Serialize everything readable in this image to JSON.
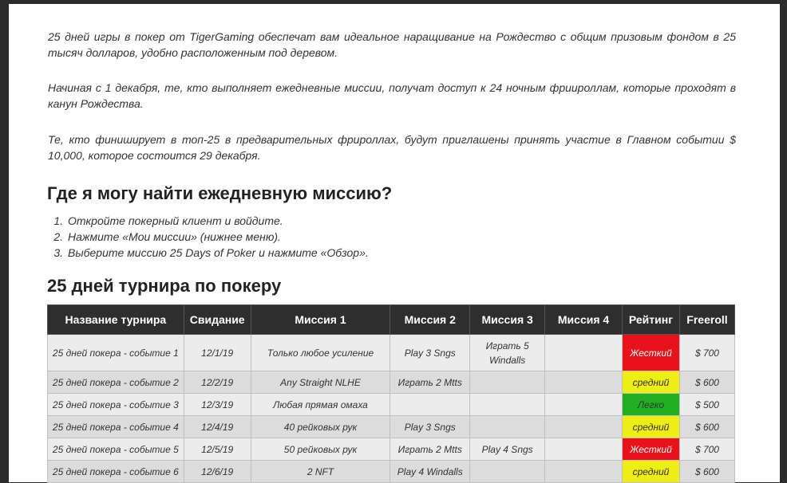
{
  "paragraphs": [
    "25 дней игры в покер от TigerGaming обеспечат вам идеальное наращивание на Рождество с общим призовым фондом в 25 тысяч долларов, удобно расположенным под деревом.",
    "Начиная с 1 декабря, те, кто выполняет ежедневные миссии, получат доступ к 24 ночным фриироллам, которые проходят в канун Рождества.",
    "Те, кто финиширует в топ-25 в предварительных фрироллах, будут приглашены принять участие в Главном событии $ 10,000, которое состоится 29 декабря."
  ],
  "heading_mission": "Где я могу найти ежедневную миссию?",
  "steps": [
    "Откройте покерный клиент и войдите.",
    "Нажмите «Мои миссии» (нижнее меню).",
    "Выберите миссию 25 Days of Poker и нажмите «Обзор»."
  ],
  "heading_table": "25 дней турнира по покеру",
  "table": {
    "headers": [
      "Название турнира",
      "Свидание",
      "Миссия 1",
      "Миссия 2",
      "Миссия 3",
      "Миссия 4",
      "Рейтинг",
      "Freeroll"
    ],
    "rows": [
      {
        "name": "25 дней покера - событие 1",
        "date": "12/1/19",
        "m1": "Только любое усиление",
        "m2": "Play 3 Sngs",
        "m3": "Играть 5 Windalls",
        "m4": "",
        "rating": "Жесткий",
        "rating_level": "hard",
        "freeroll": "$ 700"
      },
      {
        "name": "25 дней покера - событие 2",
        "date": "12/2/19",
        "m1": "Any Straight NLHE",
        "m2": "Играть 2 Mtts",
        "m3": "",
        "m4": "",
        "rating": "средний",
        "rating_level": "mid",
        "freeroll": "$ 600"
      },
      {
        "name": "25 дней покера - событие 3",
        "date": "12/3/19",
        "m1": "Любая прямая омаха",
        "m2": "",
        "m3": "",
        "m4": "",
        "rating": "Легко",
        "rating_level": "easy",
        "freeroll": "$ 500"
      },
      {
        "name": "25 дней покера - событие 4",
        "date": "12/4/19",
        "m1": "40 рейковых рук",
        "m2": "Play 3 Sngs",
        "m3": "",
        "m4": "",
        "rating": "средний",
        "rating_level": "mid",
        "freeroll": "$ 600"
      },
      {
        "name": "25 дней покера - событие 5",
        "date": "12/5/19",
        "m1": "50 рейковых рук",
        "m2": "Играть 2 Mtts",
        "m3": "Play 4 Sngs",
        "m4": "",
        "rating": "Жесткий",
        "rating_level": "hard",
        "freeroll": "$ 700"
      },
      {
        "name": "25 дней покера - событие 6",
        "date": "12/6/19",
        "m1": "2 NFT",
        "m2": "Play 4 Windalls",
        "m3": "",
        "m4": "",
        "rating": "средний",
        "rating_level": "mid",
        "freeroll": "$ 600"
      }
    ]
  },
  "colors": {
    "hard": "#e8121a",
    "mid": "#eeee15",
    "easy": "#22b022",
    "header_bg": "#2e2e2e"
  }
}
